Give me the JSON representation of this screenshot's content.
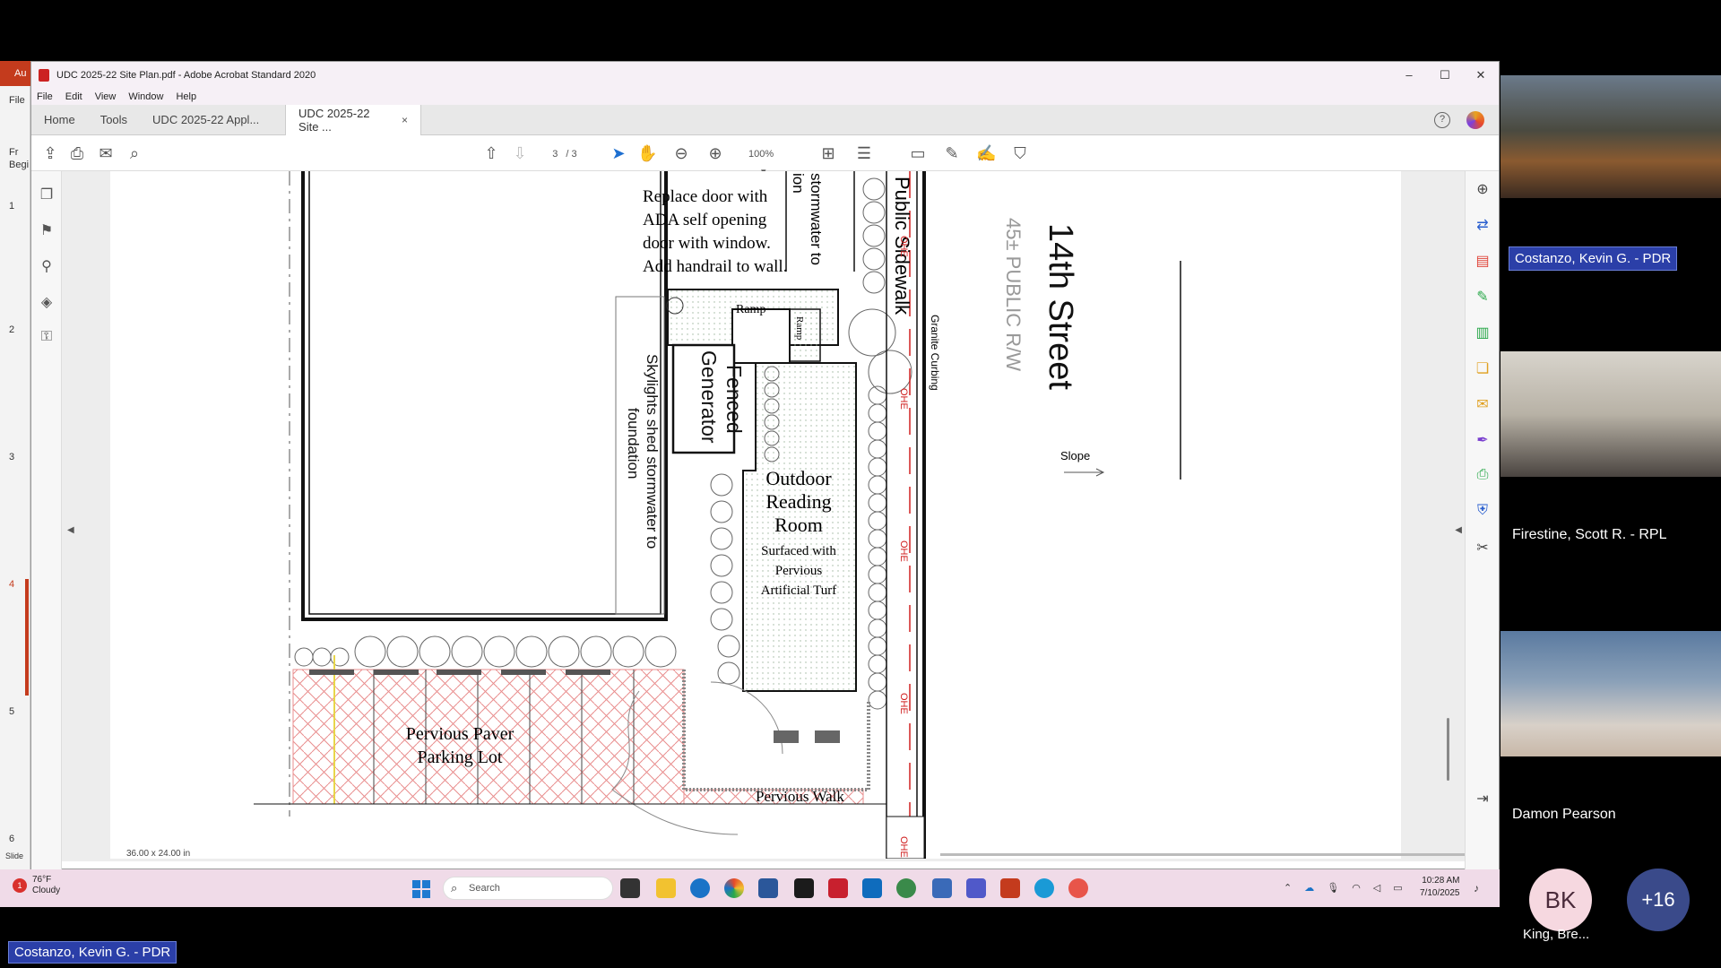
{
  "window": {
    "title": "UDC 2025-22 Site Plan.pdf - Adobe Acrobat Standard 2020",
    "controls": [
      "–",
      "☐",
      "✕"
    ]
  },
  "menu": [
    "File",
    "Edit",
    "View",
    "Window",
    "Help"
  ],
  "tabs": {
    "home": "Home",
    "tools": "Tools",
    "doc1": "UDC 2025-22 Appl...",
    "doc2": "UDC 2025-22 Site ...",
    "close": "×"
  },
  "toolbar": {
    "page_current": "3",
    "page_total": "/ 3",
    "zoom": "100%"
  },
  "document": {
    "size_label": "36.00 x 24.00 in"
  },
  "plan": {
    "door_note": [
      "Replace door with",
      "ADA self opening",
      "door with window.",
      "Add handrail to wall."
    ],
    "stormwater_note": [
      "stormwater to",
      "ion"
    ],
    "public_sidewalk": "Public Sidewalk",
    "granite_curbing": "Granite Curbing",
    "street_name": "14th Street",
    "row_note": "45± PUBLIC R/W",
    "slope": "Slope",
    "ramp": "Ramp",
    "ramp2": "Ramp",
    "generator": [
      "Fenced",
      "Generator"
    ],
    "skylights_note": [
      "Skylights shed stormwater to",
      "foundation"
    ],
    "reading_room": [
      "Outdoor",
      "Reading",
      "Room"
    ],
    "surfaced_note": [
      "Surfaced with",
      "Pervious",
      "Artificial Turf"
    ],
    "parking": [
      "Pervious Paver",
      "Parking Lot"
    ],
    "walk": "Pervious Walk",
    "ohe": "OHE"
  },
  "background_app": {
    "tab": "Au",
    "file_menu": "File",
    "labels": [
      "Fr",
      "Begi"
    ],
    "slide_numbers": [
      "1",
      "2",
      "3",
      "4",
      "5",
      "6"
    ],
    "slide_footer": "Slide"
  },
  "taskbar": {
    "temperature": "76°F",
    "condition": "Cloudy",
    "search_placeholder": "Search",
    "time": "10:28 AM",
    "date": "7/10/2025",
    "weather_badge": "1"
  },
  "participants": {
    "tile1_tag": "Costanzo, Kevin G. - PDR",
    "tile2_name": "Firestine, Scott R. - RPL",
    "tile3_name": "Damon Pearson",
    "avatar_initials": "BK",
    "avatar_name": "King, Bre...",
    "more_count": "+16"
  },
  "bottom_tag": "Costanzo, Kevin G. - PDR",
  "colors": {
    "zoom_tag": "#2b3fa8",
    "paver": "#f4a6a6",
    "ohe_line": "#d02020",
    "taskbar": "#f0dbe8"
  }
}
